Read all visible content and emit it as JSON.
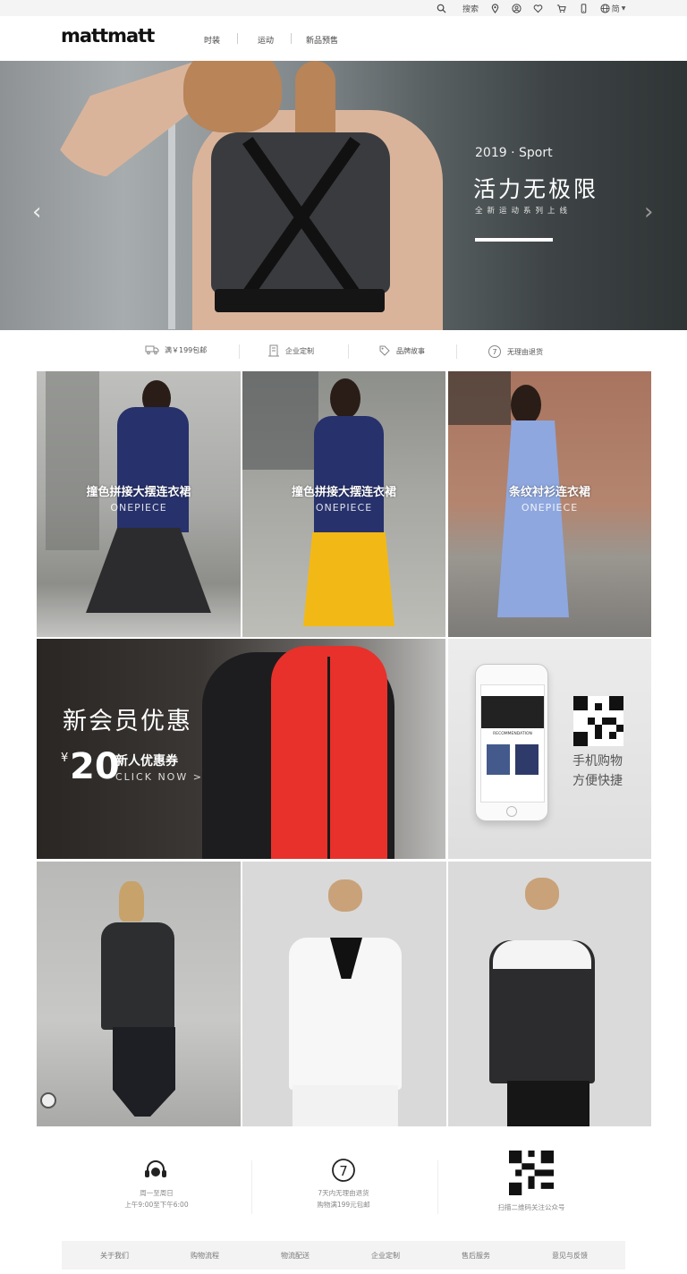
{
  "utility_bar": {
    "search_label": "搜索",
    "language_label": "简"
  },
  "header": {
    "logo": "mattmatt",
    "nav": [
      "时装",
      "运动",
      "新品预售"
    ]
  },
  "hero": {
    "year_line": "2019 · Sport",
    "title": "活力无极限",
    "subtitle": "全新运动系列上线"
  },
  "services": [
    {
      "icon": "truck-icon",
      "label": "满￥199包邮"
    },
    {
      "icon": "building-icon",
      "label": "企业定制"
    },
    {
      "icon": "tag-icon",
      "label": "品牌故事"
    },
    {
      "icon": "seven-day-icon",
      "label": "无理由退货"
    }
  ],
  "products_row1": [
    {
      "title": "撞色拼接大摆连衣裙",
      "subtitle": "ONEPIECE"
    },
    {
      "title": "撞色拼接大摆连衣裙",
      "subtitle": "ONEPIECE"
    },
    {
      "title": "条纹衬衫连衣裙",
      "subtitle": "ONEPIECE"
    }
  ],
  "promo": {
    "title": "新会员优惠",
    "currency": "¥",
    "amount": "20",
    "coupon": "新人优惠券",
    "cta": "CLICK NOW >"
  },
  "mobile_promo": {
    "line1": "手机购物",
    "line2": "方便快捷",
    "phone_label": "RECOMMENDATION"
  },
  "info": [
    {
      "icon": "headset-icon",
      "line1": "周一至周日",
      "line2": "上午9:00至下午6:00"
    },
    {
      "icon": "seven-day-icon",
      "line1": "7天内无理由退货",
      "line2": "购物满199元包邮"
    },
    {
      "icon": "qr-code-icon",
      "line1": "扫描二维码关注公众号",
      "line2": ""
    }
  ],
  "footer": [
    "关于我们",
    "购物流程",
    "物流配送",
    "企业定制",
    "售后服务",
    "意见与反馈"
  ],
  "colors": {
    "navy": "#27316b",
    "yellow": "#f2b916",
    "red": "#e8312a",
    "light_blue": "#8ea7df"
  }
}
